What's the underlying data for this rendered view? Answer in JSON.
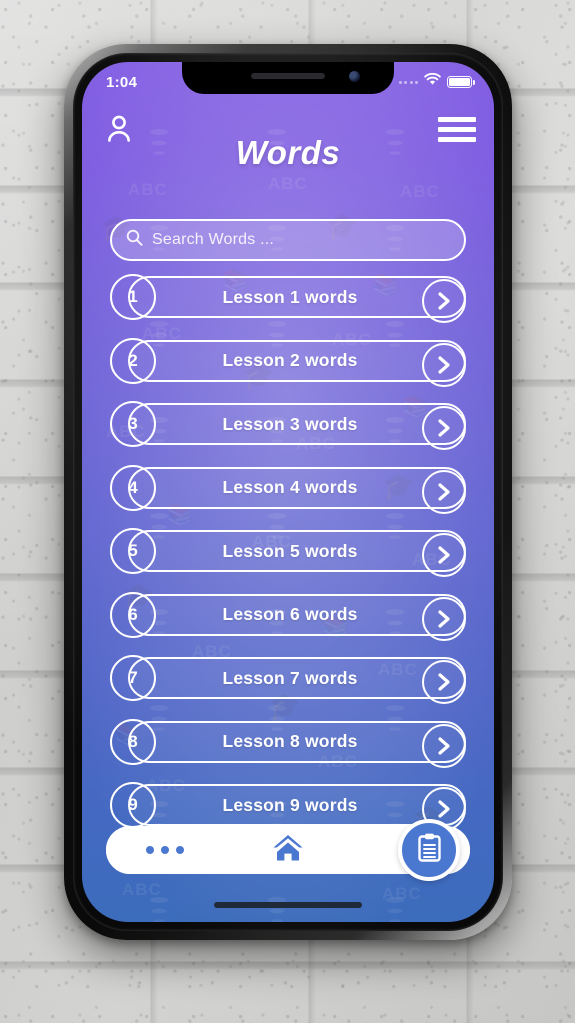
{
  "wallpaper": {
    "description": "white painted brick wall"
  },
  "device": {
    "frame_color": "#101010"
  },
  "status_bar": {
    "time": "1:04",
    "wifi_icon": "wifi-icon",
    "battery_icon": "battery-full-icon",
    "signal_icon": "signal-dots-icon"
  },
  "header": {
    "title": "Words",
    "profile_icon": "user-profile-icon",
    "menu_icon": "hamburger-menu-icon"
  },
  "search": {
    "placeholder": "Search Words ...",
    "value": "",
    "icon": "search-icon"
  },
  "lessons": [
    {
      "number": "1",
      "label": "Lesson 1 words"
    },
    {
      "number": "2",
      "label": "Lesson 2 words"
    },
    {
      "number": "3",
      "label": "Lesson 3 words"
    },
    {
      "number": "4",
      "label": "Lesson 4 words"
    },
    {
      "number": "5",
      "label": "Lesson 5 words"
    },
    {
      "number": "6",
      "label": "Lesson 6 words"
    },
    {
      "number": "7",
      "label": "Lesson 7 words"
    },
    {
      "number": "8",
      "label": "Lesson 8 words"
    },
    {
      "number": "9",
      "label": "Lesson 9 words"
    }
  ],
  "bottom_nav": {
    "more_icon": "more-dots-icon",
    "home_icon": "home-icon",
    "clipboard_icon": "clipboard-icon",
    "accent_color": "#4a77cf"
  },
  "theme": {
    "gradient_top": "#8a63f0",
    "gradient_bottom": "#4277cf",
    "foreground": "#ffffff"
  },
  "watermarks": [
    "ABC",
    "ABC",
    "ABC",
    "ABC",
    "ABC",
    "ABC",
    "ABC",
    "ABC",
    "ABC"
  ]
}
